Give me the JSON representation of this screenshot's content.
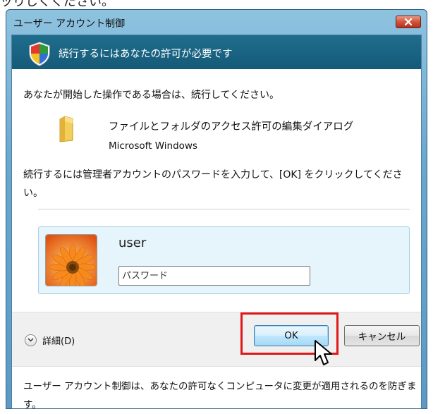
{
  "top_fragment": "ッりしくください。",
  "window": {
    "title": "ユーザー アカウント制御",
    "close_icon": "close-icon"
  },
  "banner": {
    "text": "続行するにはあなたの許可が必要です",
    "icon": "shield-icon"
  },
  "body": {
    "line1": "あなたが開始した操作である場合は、続行してください。",
    "program_name": "ファイルとフォルダのアクセス許可の編集ダイアログ",
    "publisher": "Microsoft Windows",
    "instruction": "続行するには管理者アカウントのパスワードを入力して、[OK] をクリックしてください。"
  },
  "credential": {
    "username": "user",
    "password_placeholder": "パスワード",
    "password_value": ""
  },
  "buttons": {
    "details_label": "詳細(D)",
    "ok_label": "OK",
    "cancel_label": "キャンセル"
  },
  "footer": {
    "text": "ユーザー アカウント制御は、あなたの許可なくコンピュータに変更が適用されるのを防ぎます。"
  },
  "colors": {
    "banner": "#1a6686",
    "highlight": "#e0181b",
    "panel": "#e6f4fb"
  }
}
